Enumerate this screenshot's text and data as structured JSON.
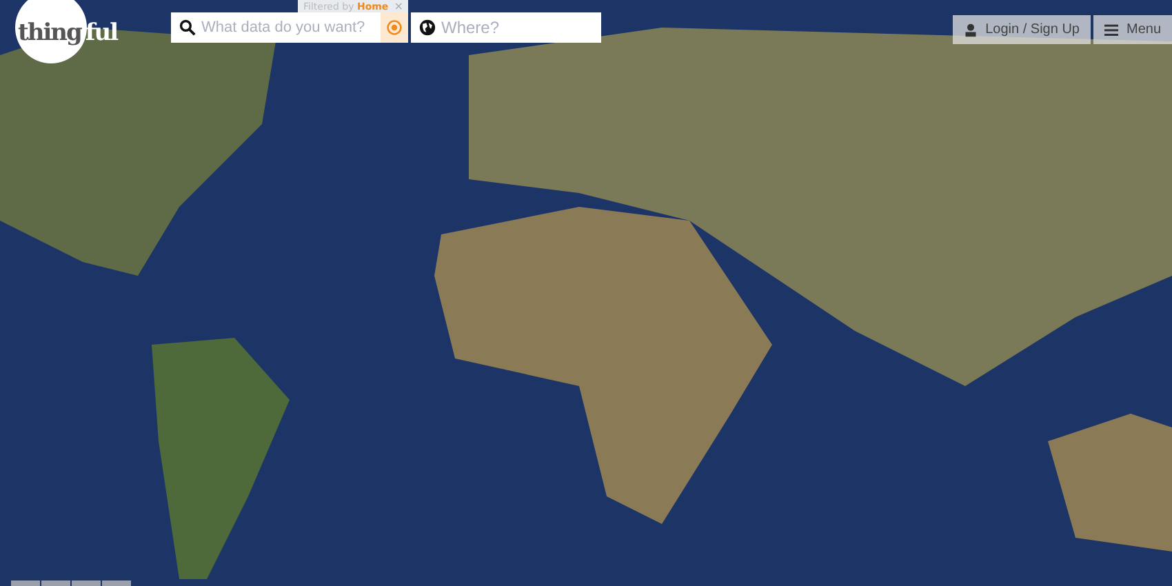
{
  "logo": {
    "circle_text": "thing",
    "outer_text": "ful"
  },
  "search": {
    "filter_label": "Filtered by **Home**",
    "filter_close": "×",
    "placeholder": "What data do you want?"
  },
  "location": {
    "placeholder": "Where?"
  },
  "buttons": [
    {
      "kind": "login",
      "label": "Login / Sign Up"
    },
    {
      "kind": "menu",
      "label": "Menu"
    }
  ],
  "map_controls": [
    {
      "kind": "tab"
    },
    {
      "kind": "tab"
    },
    {
      "kind": "tab"
    },
    {
      "kind": "tab"
    }
  ]
}
